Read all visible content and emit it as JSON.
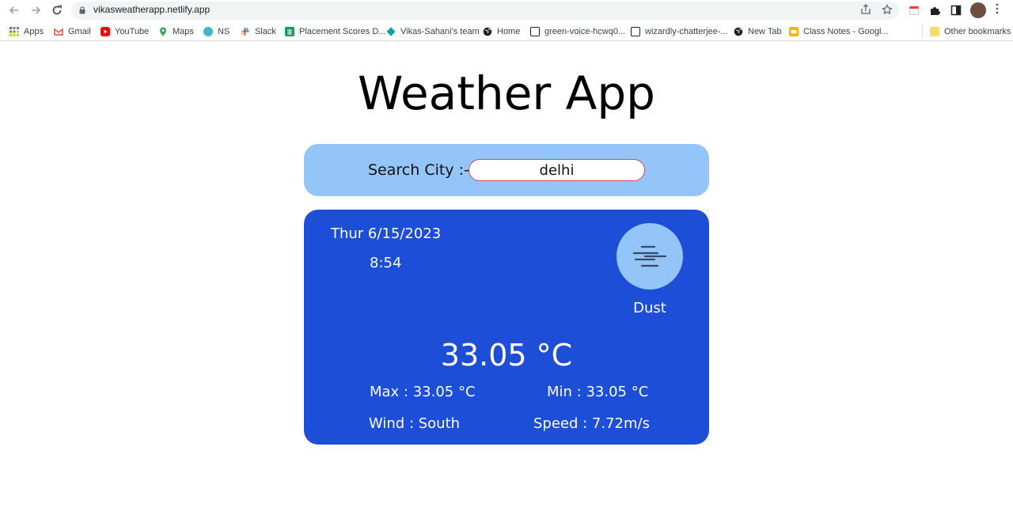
{
  "browser": {
    "url": "vikasweatherapp.netlify.app",
    "bookmarks": [
      {
        "label": "Apps",
        "color": "#4285f4"
      },
      {
        "label": "Gmail",
        "color": "#ea4335"
      },
      {
        "label": "YouTube",
        "color": "#ff0000"
      },
      {
        "label": "Maps",
        "color": "#34a853"
      },
      {
        "label": "NS",
        "color": "#3fb7c4"
      },
      {
        "label": "Slack",
        "color": "#e01e5a"
      },
      {
        "label": "Placement Scores D...",
        "color": "#0f9d58"
      },
      {
        "label": "Vikas-Sahani's team",
        "color": "#00a3a3"
      },
      {
        "label": "Home",
        "color": "#202124"
      },
      {
        "label": "green-voice-hcwq0...",
        "color": "#202124"
      },
      {
        "label": "wizardly-chatterjee-...",
        "color": "#202124"
      },
      {
        "label": "New Tab",
        "color": "#202124"
      },
      {
        "label": "Class Notes - Googl...",
        "color": "#f4b400"
      }
    ],
    "other_bookmarks": "Other bookmarks"
  },
  "app": {
    "title": "Weather App",
    "search": {
      "label": "Search City :-",
      "value": "delhi"
    },
    "weather": {
      "date": "Thur 6/15/2023",
      "time": "8:54",
      "icon": "fog-haze-icon",
      "condition": "Dust",
      "temperature": "33.05 °C",
      "max": "Max : 33.05 °C",
      "min": "Min : 33.05 °C",
      "wind": "Wind : South",
      "speed": "Speed : 7.72m/s"
    }
  },
  "colors": {
    "search_panel": "#93c5f9",
    "card": "#1d4ed8",
    "icon_circle": "#93c5f9",
    "input_border": "#d6475f"
  }
}
